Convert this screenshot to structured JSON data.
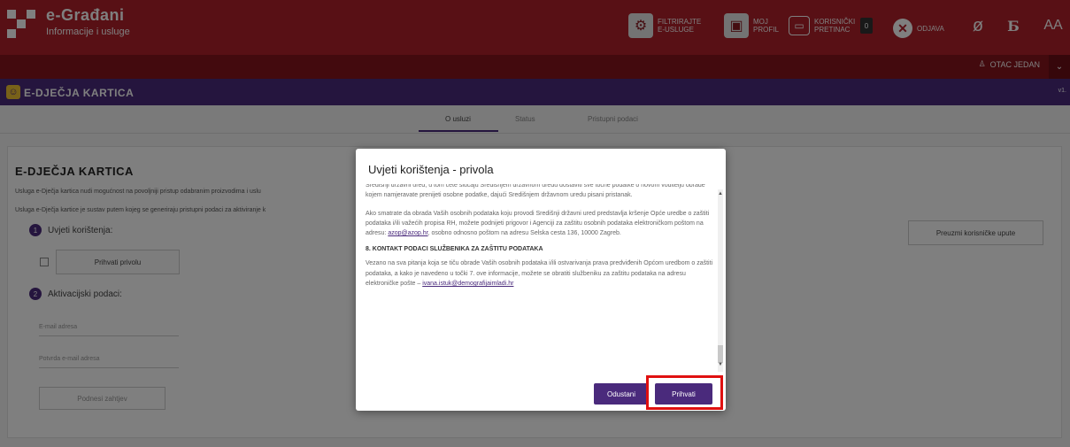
{
  "header": {
    "brand_title": "e-Građani",
    "brand_subtitle": "Informacije i usluge",
    "filter_label_1": "FILTRIRAJTE",
    "filter_label_2": "E-USLUGE",
    "profile_label_1": "MOJ",
    "profile_label_2": "PROFIL",
    "inbox_label_1": "KORISNIČKI",
    "inbox_label_2": "PRETINAC",
    "inbox_count": "0",
    "logout_label": "ODJAVA",
    "contrast_icon": "ø",
    "font_icon": "Б",
    "textsize_label": "AA"
  },
  "userbar": {
    "user_name": "OTAC JEDAN"
  },
  "app": {
    "title": "E-DJEČJA KARTICA",
    "version": "v1."
  },
  "tabs": [
    {
      "label": "O usluzi",
      "active": true
    },
    {
      "label": "Status",
      "active": false
    },
    {
      "label": "Pristupni podaci",
      "active": false
    }
  ],
  "page": {
    "title": "E-DJEČJA KARTICA",
    "intro_1": "Usluga e-Dječja kartica nudi mogućnost na povoljniji pristup odabranim proizvodima i uslu",
    "intro_2": "Usluga e-Dječja kartice je sustav putem kojeg se generiraju pristupni podaci za aktiviranje k",
    "step1_number": "1",
    "step1_label": "Uvjeti korištenja:",
    "accept_consent": "Prihvati privolu",
    "step2_number": "2",
    "step2_label": "Aktivacijski podaci:",
    "email_placeholder": "E-mail adresa",
    "email_confirm_placeholder": "Potvrda e-mail adresa",
    "submit_label": "Podnesi zahtjev",
    "manual_label": "Preuzmi korisničke upute"
  },
  "modal": {
    "title": "Uvjeti korištenja - privola",
    "p1": "Središnji državni ured, u tom ćete slučaju Središnjem državnom uredu dostaviti sve točne podatke o novom voditelju obrade kojem namjeravate prenijeti osobne podatke, dajući Središnjem državnom uredu pisani pristanak.",
    "p2_text": "Ako smatrate da obrada Vaših osobnih podataka koju provodi Središnji državni ured predstavlja kršenje Opće uredbe o zaštiti podataka i/ili važećih propisa RH, možete podnijeti prigovor i Agenciji za zaštitu osobnih podataka elektroničkom poštom na adresu:",
    "p2_link": "azop@azop.hr",
    "p2_tail": ", osobno odnosno poštom na adresu Selska cesta 136, 10000 Zagreb.",
    "h8": "8. KONTAKT PODACI SLUŽBENIKA ZA ZAŠTITU PODATAKA",
    "p3_text": "Vezano na sva pitanja koja se tiču obrade Vaših osobnih podataka i/ili ostvarivanja prava predviđenih Općom uredbom o zaštiti podataka, a kako je navedeno u točki 7. ove informacije, možete se obratiti službeniku za zaštitu podataka na adresu elektroničke pošte –",
    "p3_link": "ivana.istuk@demografijaimladi.hr",
    "cancel_label": "Odustani",
    "accept_label": "Prihvati"
  },
  "colors": {
    "header_red": "#b0202a",
    "dark_red": "#86141c",
    "purple": "#4a2a7c",
    "highlight": "#e01010"
  }
}
